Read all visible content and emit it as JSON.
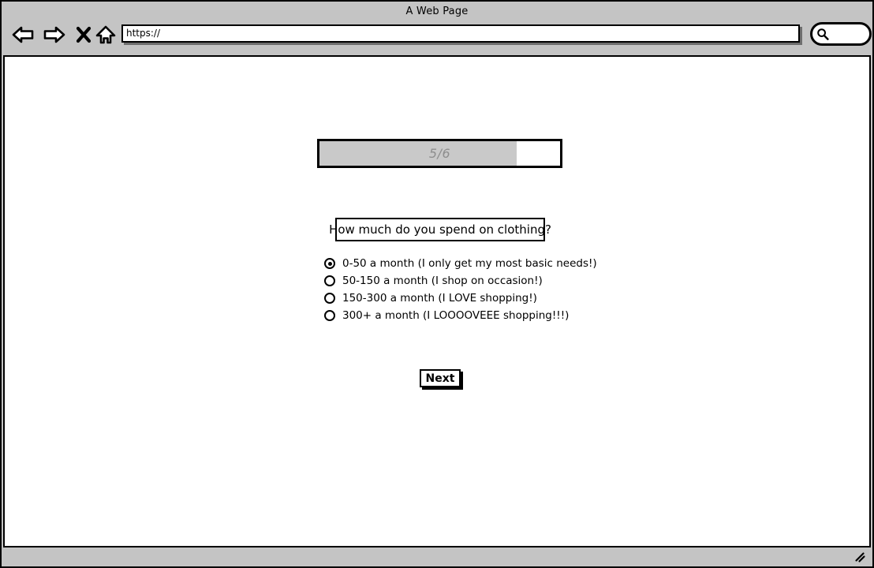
{
  "browser": {
    "title": "A Web Page",
    "url_value": "https://",
    "url_placeholder": "https://",
    "nav": {
      "back_label": "Back",
      "forward_label": "Forward",
      "stop_label": "Stop",
      "home_label": "Home"
    },
    "search": {
      "value": "",
      "placeholder": ""
    }
  },
  "survey": {
    "progress": {
      "label": "5/6",
      "current": 5,
      "total": 6,
      "percent": 82,
      "fill_color": "#c9c9c9",
      "text_color": "#8e8e8e"
    },
    "question": "How much do you spend on clothing?",
    "options": [
      {
        "label": "0-50 a month (I only get my most basic needs!)",
        "selected": true
      },
      {
        "label": "50-150 a month (I shop on occasion!)",
        "selected": false
      },
      {
        "label": "150-300 a month (I LOVE shopping!)",
        "selected": false
      },
      {
        "label": "300+ a month (I LOOOOVEEE shopping!!!)",
        "selected": false
      }
    ],
    "next_label": "Next"
  },
  "icons": {
    "back": "left-arrow-icon",
    "forward": "right-arrow-icon",
    "stop": "close-x-icon",
    "home": "home-icon",
    "search": "search-icon",
    "resize": "resize-grip-icon"
  },
  "colors": {
    "chrome_background": "#c4c4c4",
    "page_background": "#ffffff",
    "outline": "#000000"
  }
}
